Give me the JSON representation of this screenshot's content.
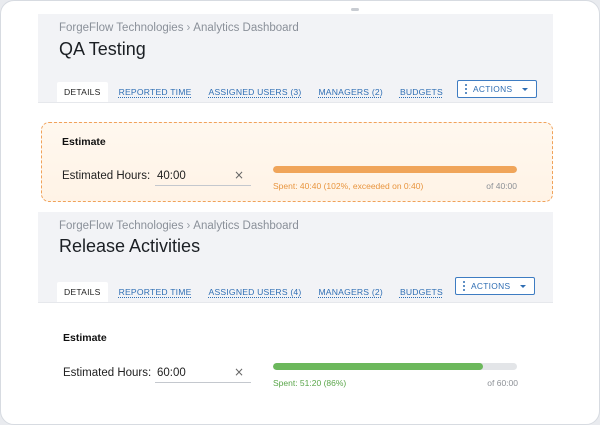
{
  "panels": [
    {
      "breadcrumb": {
        "company": "ForgeFlow Technologies",
        "separator": "›",
        "page": "Analytics Dashboard"
      },
      "title": "QA Testing",
      "tabs": [
        "DETAILS",
        "REPORTED TIME",
        "ASSIGNED USERS (3)",
        "MANAGERS (2)",
        "BUDGETS"
      ],
      "actions_label": "ACTIONS",
      "estimate": {
        "heading": "Estimate",
        "label": "Estimated Hours:",
        "value": "40:00",
        "clear_glyph": "×",
        "progress_percent": 100,
        "bar_color": "#f0a55a",
        "spent_text": "Spent: 40:40 (102%, exceeded on 0:40)",
        "spent_color": "#e8953f",
        "of_text": "of 40:00"
      }
    },
    {
      "breadcrumb": {
        "company": "ForgeFlow Technologies",
        "separator": "›",
        "page": "Analytics Dashboard"
      },
      "title": "Release Activities",
      "tabs": [
        "DETAILS",
        "REPORTED TIME",
        "ASSIGNED USERS (4)",
        "MANAGERS (2)",
        "BUDGETS"
      ],
      "actions_label": "ACTIONS",
      "estimate": {
        "heading": "Estimate",
        "label": "Estimated Hours:",
        "value": "60:00",
        "clear_glyph": "×",
        "progress_percent": 86,
        "bar_color": "#6cb85c",
        "spent_text": "Spent: 51:20 (86%)",
        "spent_color": "#5aa64a",
        "of_text": "of 60:00"
      }
    }
  ]
}
